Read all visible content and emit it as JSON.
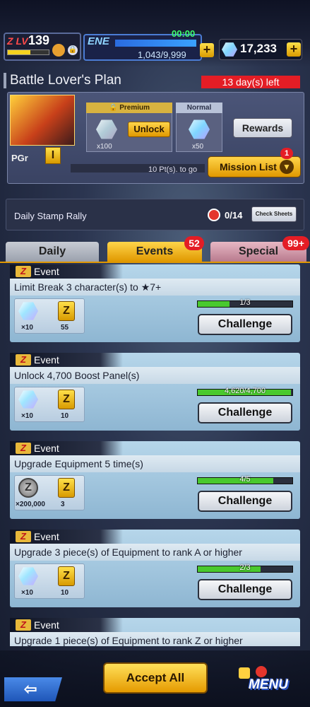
{
  "player": {
    "level_prefix": "Z LV",
    "level": "139"
  },
  "energy": {
    "label": "ENE",
    "timer": "00:00",
    "value": "1,043/9,999"
  },
  "gems": {
    "value": "17,233"
  },
  "plan": {
    "title": "Battle Lover's Plan",
    "days_left": "13 day(s) left",
    "rank": "PGr",
    "rank_badge": "I",
    "points_to_go": "10 Pt(s). to go",
    "premium_label": "Premium",
    "normal_label": "Normal",
    "premium_qty": "x100",
    "normal_qty": "x50",
    "unlock_label": "Unlock",
    "rewards_label": "Rewards",
    "mission_list_label": "Mission List",
    "mission_badge": "1"
  },
  "stamp": {
    "label": "Daily Stamp Rally",
    "count": "0/14",
    "check_label": "Check Sheets"
  },
  "tabs": [
    {
      "label": "Daily",
      "badge": ""
    },
    {
      "label": "Events",
      "badge": "52"
    },
    {
      "label": "Special",
      "badge": "99+"
    }
  ],
  "events": [
    {
      "tag": "Event",
      "title": "Limit Break 3 character(s) to ★7+",
      "reward1_qty": "×10",
      "reward1_type": "gem",
      "reward2_qty": "55",
      "progress": "1/3",
      "progress_fraction": 0.333,
      "button": "Challenge"
    },
    {
      "tag": "Event",
      "title": "Unlock 4,700 Boost Panel(s)",
      "reward1_qty": "×10",
      "reward1_type": "gem",
      "reward2_qty": "10",
      "progress": "4,620/4,700",
      "progress_fraction": 0.983,
      "button": "Challenge"
    },
    {
      "tag": "Event",
      "title": "Upgrade Equipment 5 time(s)",
      "reward1_qty": "×200,000",
      "reward1_type": "coin",
      "reward2_qty": "3",
      "progress": "4/5",
      "progress_fraction": 0.8,
      "button": "Challenge"
    },
    {
      "tag": "Event",
      "title": "Upgrade 3 piece(s) of Equipment to rank A or higher",
      "reward1_qty": "×10",
      "reward1_type": "gem",
      "reward2_qty": "10",
      "progress": "2/3",
      "progress_fraction": 0.667,
      "button": "Challenge"
    },
    {
      "tag": "Event",
      "title": "Upgrade 1 piece(s) of Equipment to rank Z or higher",
      "reward1_qty": "",
      "reward1_type": "gem",
      "reward2_qty": "",
      "progress": "",
      "progress_fraction": 0,
      "button": ""
    }
  ],
  "bottom": {
    "accept_all": "Accept All",
    "menu": "MENU"
  }
}
